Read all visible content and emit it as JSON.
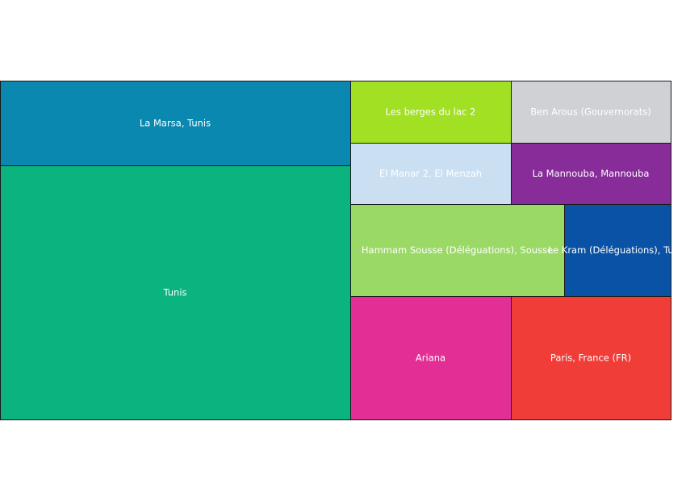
{
  "chart_data": {
    "type": "treemap",
    "title": "",
    "tiles": [
      {
        "label": "Tunis",
        "color": "#0bb37f"
      },
      {
        "label": "La Marsa, Tunis",
        "color": "#0b88b0"
      },
      {
        "label": "Les berges du lac 2",
        "color": "#a2e023"
      },
      {
        "label": "Ben Arous (Gouvernorats)",
        "color": "#d0d1d5"
      },
      {
        "label": "El Manar 2, El Menzah",
        "color": "#cae0f2"
      },
      {
        "label": "La Mannouba, Mannouba",
        "color": "#882c9a"
      },
      {
        "label": "Hammam Sousse (Déléguations), Sousse",
        "color": "#9bd966"
      },
      {
        "label": "Le Kram (Déléguations), Tunis",
        "color": "#0a52a5"
      },
      {
        "label": "Ariana",
        "color": "#e22e95"
      },
      {
        "label": "Paris, France (FR)",
        "color": "#f13d38"
      }
    ]
  }
}
